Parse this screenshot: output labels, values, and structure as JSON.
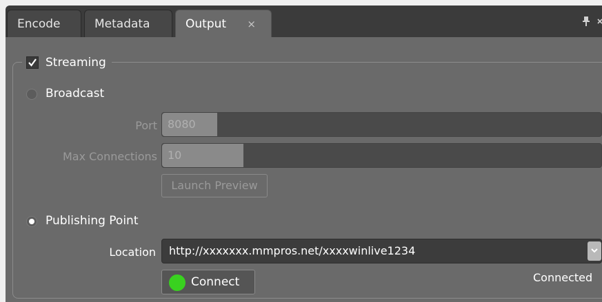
{
  "tabs": [
    {
      "label": "Encode"
    },
    {
      "label": "Metadata"
    },
    {
      "label": "Output",
      "close": "×",
      "active": true
    }
  ],
  "streaming": {
    "label": "Streaming",
    "checked": true
  },
  "broadcast": {
    "label": "Broadcast",
    "selected": false,
    "port_label": "Port",
    "port_value": "8080",
    "max_connections_label": "Max Connections",
    "max_connections_value": "10",
    "launch_preview_label": "Launch Preview"
  },
  "publishing_point": {
    "label": "Publishing Point",
    "selected": true,
    "location_label": "Location",
    "location_value": "http://xxxxxxx.mmpros.net/xxxxwinlive1234",
    "connect_label": "Connect",
    "status_text": "Connected"
  },
  "colors": {
    "connect_indicator": "#39d11f"
  },
  "icons": {
    "pin": "pin-icon",
    "panel_close": "close-icon",
    "checkbox_check": "check-icon",
    "dropdown": "chevron-down-icon"
  }
}
